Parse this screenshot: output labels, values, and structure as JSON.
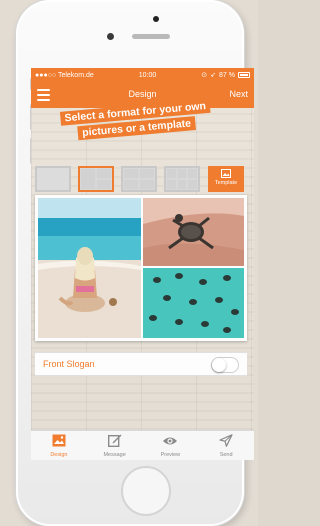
{
  "status": {
    "carrier": "●●●○○ Telekom.de",
    "time": "10:00",
    "battery": "87 %"
  },
  "nav": {
    "title": "Design",
    "next_label": "Next"
  },
  "banner": {
    "line1": "Select a format for your own",
    "line2": "pictures or a template"
  },
  "formats": {
    "selected_index": 1,
    "template_label": "Template"
  },
  "slogan": {
    "label": "Front Slogan",
    "enabled": false
  },
  "tabs": [
    {
      "label": "Design",
      "icon": "image-icon",
      "active": true
    },
    {
      "label": "Message",
      "icon": "pencil-icon",
      "active": false
    },
    {
      "label": "Preview",
      "icon": "eye-icon",
      "active": false
    },
    {
      "label": "Send",
      "icon": "paper-plane-icon",
      "active": false
    }
  ],
  "colors": {
    "accent": "#ef7c2f"
  }
}
